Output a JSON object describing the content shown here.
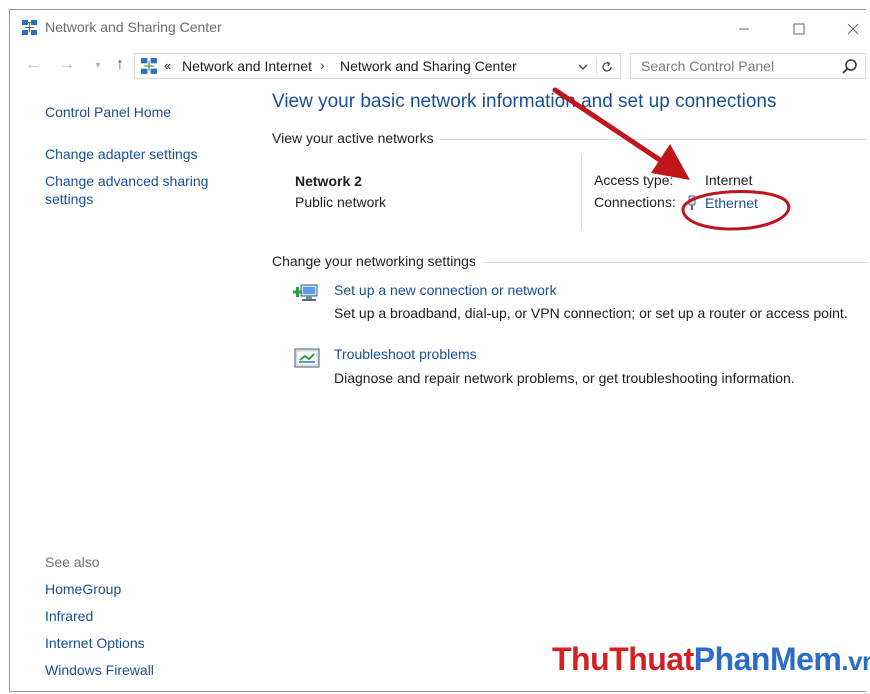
{
  "window": {
    "title": "Network and Sharing Center"
  },
  "address": {
    "chevron": "«",
    "crumbs": [
      "Network and Internet",
      "Network and Sharing Center"
    ],
    "separator": "›"
  },
  "search": {
    "placeholder": "Search Control Panel"
  },
  "sidebar": {
    "items": [
      "Control Panel Home",
      "Change adapter settings",
      "Change advanced sharing settings"
    ],
    "see_also_label": "See also",
    "see_also": [
      "HomeGroup",
      "Infrared",
      "Internet Options",
      "Windows Firewall"
    ]
  },
  "main": {
    "title": "View your basic network information and set up connections",
    "active_networks_label": "View your active networks",
    "network": {
      "name": "Network  2",
      "type": "Public network",
      "access_type_label": "Access type:",
      "access_type_value": "Internet",
      "connections_label": "Connections:",
      "connections_value": "Ethernet"
    },
    "change_settings_label": "Change your networking settings",
    "tasks": [
      {
        "link": "Set up a new connection or network",
        "desc": "Set up a broadband, dial-up, or VPN connection; or set up a router or access point."
      },
      {
        "link": "Troubleshoot problems",
        "desc": "Diagnose and repair network problems, or get troubleshooting information."
      }
    ]
  },
  "watermark": {
    "part1": "ThuThuat",
    "part2": "PhanMem",
    "part3": ".vn"
  },
  "colors": {
    "link": "#1a4f94",
    "annotation": "#c0151b"
  }
}
